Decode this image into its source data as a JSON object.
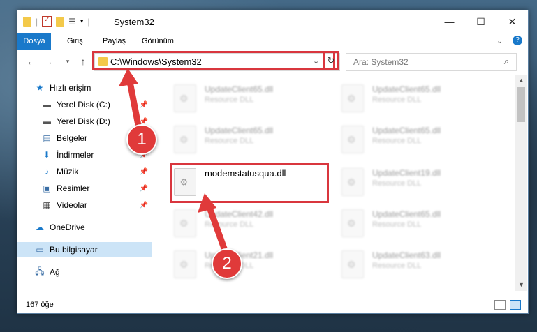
{
  "window": {
    "title": "System32"
  },
  "ribbon": {
    "tabs": [
      "Dosya",
      "Giriş",
      "Paylaş",
      "Görünüm"
    ]
  },
  "nav": {
    "address": "C:\\Windows\\System32",
    "search_placeholder": "Ara: System32"
  },
  "sidebar": {
    "items": [
      {
        "label": "Hızlı erişim",
        "icon": "star-icon"
      },
      {
        "label": "Yerel Disk (C:)",
        "icon": "drive-icon",
        "pinned": true
      },
      {
        "label": "Yerel Disk (D:)",
        "icon": "drive-icon",
        "pinned": true
      },
      {
        "label": "Belgeler",
        "icon": "document-icon",
        "pinned": true
      },
      {
        "label": "İndirmeler",
        "icon": "download-icon",
        "pinned": true
      },
      {
        "label": "Müzik",
        "icon": "music-icon",
        "pinned": true
      },
      {
        "label": "Resimler",
        "icon": "pictures-icon",
        "pinned": true
      },
      {
        "label": "Videolar",
        "icon": "video-icon",
        "pinned": true
      },
      {
        "label": "OneDrive",
        "icon": "cloud-icon"
      },
      {
        "label": "Bu bilgisayar",
        "icon": "computer-icon",
        "selected": true
      },
      {
        "label": "Ağ",
        "icon": "network-icon"
      }
    ]
  },
  "files": {
    "focused": {
      "name": "modemstatusqua.dll"
    },
    "tiles": [
      {
        "name": "UpdateClient65.dll",
        "desc": "Resource DLL"
      },
      {
        "name": "UpdateClient65.dll",
        "desc": "Resource DLL"
      },
      {
        "name": "UpdateClient65.dll",
        "desc": "Resource DLL"
      },
      {
        "name": "UpdateClient65.dll",
        "desc": "Resource DLL"
      },
      {
        "name": "UpdateClient19.dll",
        "desc": "Resource DLL"
      },
      {
        "name": "UpdateClient42.dll",
        "desc": "Resource DLL"
      },
      {
        "name": "UpdateClient65.dll",
        "desc": "Resource DLL"
      },
      {
        "name": "UpdateClient21.dll",
        "desc": "Resource DLL"
      },
      {
        "name": "UpdateClient63.dll",
        "desc": "Resource DLL"
      }
    ]
  },
  "status": {
    "count": "167 öğe"
  },
  "callouts": {
    "one": "1",
    "two": "2"
  },
  "colors": {
    "accent": "#1979ca",
    "highlight": "#d9363e",
    "selection": "#cce4f7"
  }
}
